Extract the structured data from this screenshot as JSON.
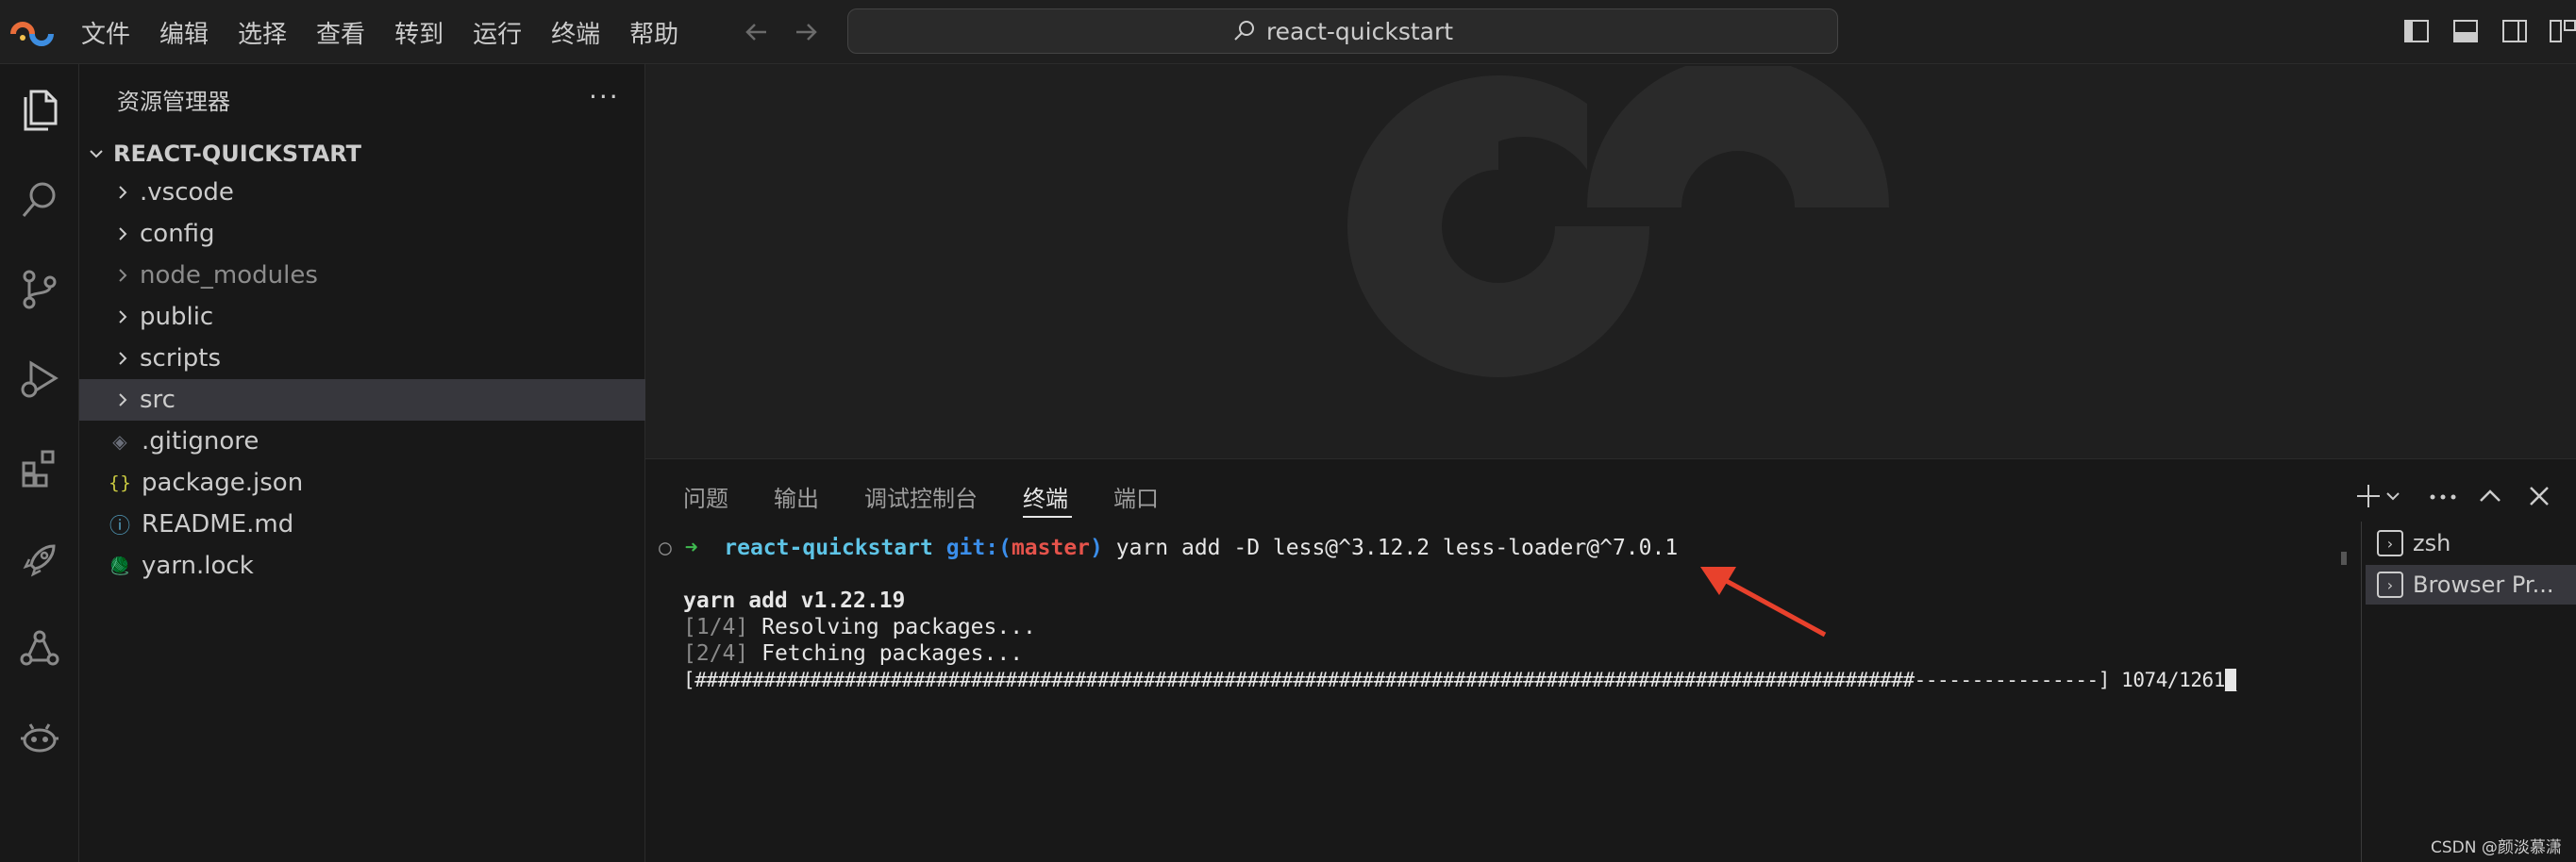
{
  "menu": [
    "文件",
    "编辑",
    "选择",
    "查看",
    "转到",
    "运行",
    "终端",
    "帮助"
  ],
  "search": {
    "text": "react-quickstart"
  },
  "sidebar": {
    "title": "资源管理器",
    "more": "···",
    "workspace": "REACT-QUICKSTART",
    "items": [
      {
        "label": ".vscode",
        "kind": "folder"
      },
      {
        "label": "config",
        "kind": "folder"
      },
      {
        "label": "node_modules",
        "kind": "folder"
      },
      {
        "label": "public",
        "kind": "folder"
      },
      {
        "label": "scripts",
        "kind": "folder"
      },
      {
        "label": "src",
        "kind": "folder"
      },
      {
        "label": ".gitignore",
        "kind": "file",
        "icon": "◈"
      },
      {
        "label": "package.json",
        "kind": "file",
        "icon": "{}"
      },
      {
        "label": "README.md",
        "kind": "file",
        "icon": "ⓘ"
      },
      {
        "label": "yarn.lock",
        "kind": "file",
        "icon": "🧶"
      }
    ]
  },
  "panel": {
    "tabs": [
      "问题",
      "输出",
      "调试控制台",
      "终端",
      "端口"
    ],
    "active_tab": "终端"
  },
  "terminal": {
    "prompt_arrow": "➜",
    "cwd": "react-quickstart",
    "git_prefix": "git:(",
    "branch": "master",
    "git_suffix": ")",
    "command": "yarn add -D less@^3.12.2 less-loader@^7.0.1",
    "version_line": "yarn add v1.22.19",
    "step1_tag": "[1/4]",
    "step1_text": "Resolving packages...",
    "step2_tag": "[2/4]",
    "step2_text": "Fetching packages...",
    "progress_bar": "[##########################################################################################################----------------]",
    "progress_count": "1074/1261",
    "progress_done": 1074,
    "progress_total": 1261
  },
  "terminal_list": [
    "zsh",
    "Browser Pr..."
  ],
  "credit": "CSDN @颜淡慕潇",
  "colors": {
    "accent_cyan": "#5ec4e6",
    "accent_blue": "#3b8eea",
    "branch_red": "#e5534b",
    "arrow_red": "#e8412c"
  }
}
